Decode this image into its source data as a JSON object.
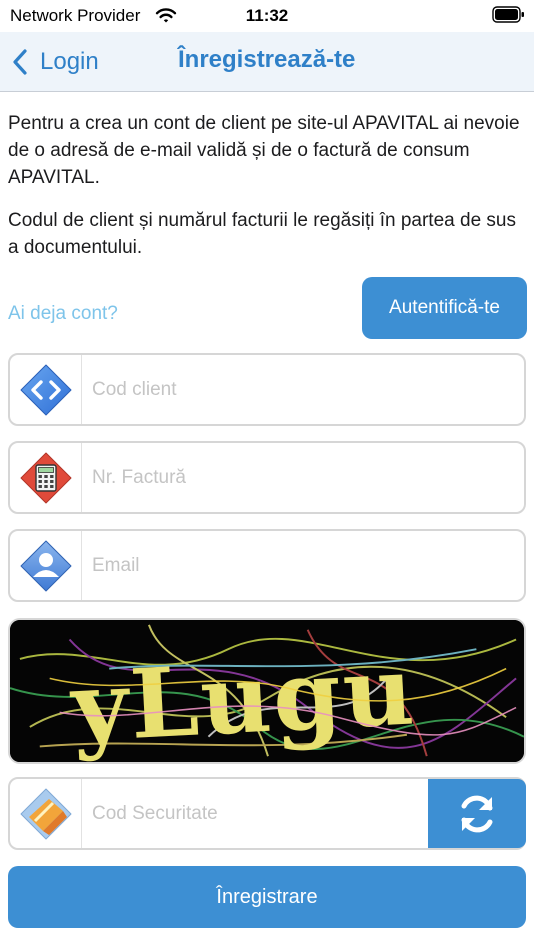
{
  "status": {
    "carrier": "Network Provider",
    "time": "11:32"
  },
  "nav": {
    "back_label": "Login",
    "title": "Înregistrează-te"
  },
  "intro": {
    "paragraph1": "Pentru a crea un cont de client pe site-ul APAVITAL ai nevoie de o adresă de e-mail validă și de o factură de consum APAVITAL.",
    "paragraph2": "Codul de client și numărul facturii le regăsiți în partea de sus a documentului."
  },
  "login_prompt": {
    "text": "Ai deja cont?",
    "button_label": "Autentifică-te"
  },
  "form": {
    "client_code": {
      "placeholder": "Cod client",
      "value": "",
      "icon": "code-icon"
    },
    "invoice_number": {
      "placeholder": "Nr. Factură",
      "value": "",
      "icon": "calculator-icon"
    },
    "email": {
      "placeholder": "Email",
      "value": "",
      "icon": "user-icon"
    },
    "security_code": {
      "placeholder": "Cod Securitate",
      "value": "",
      "icon": "shield-icon"
    }
  },
  "captcha": {
    "text": "yLugu"
  },
  "register_button": "Înregistrare",
  "colors": {
    "accent": "#3d8fd3",
    "link": "#7ec4ea",
    "nav_background": "#eef4fa"
  }
}
